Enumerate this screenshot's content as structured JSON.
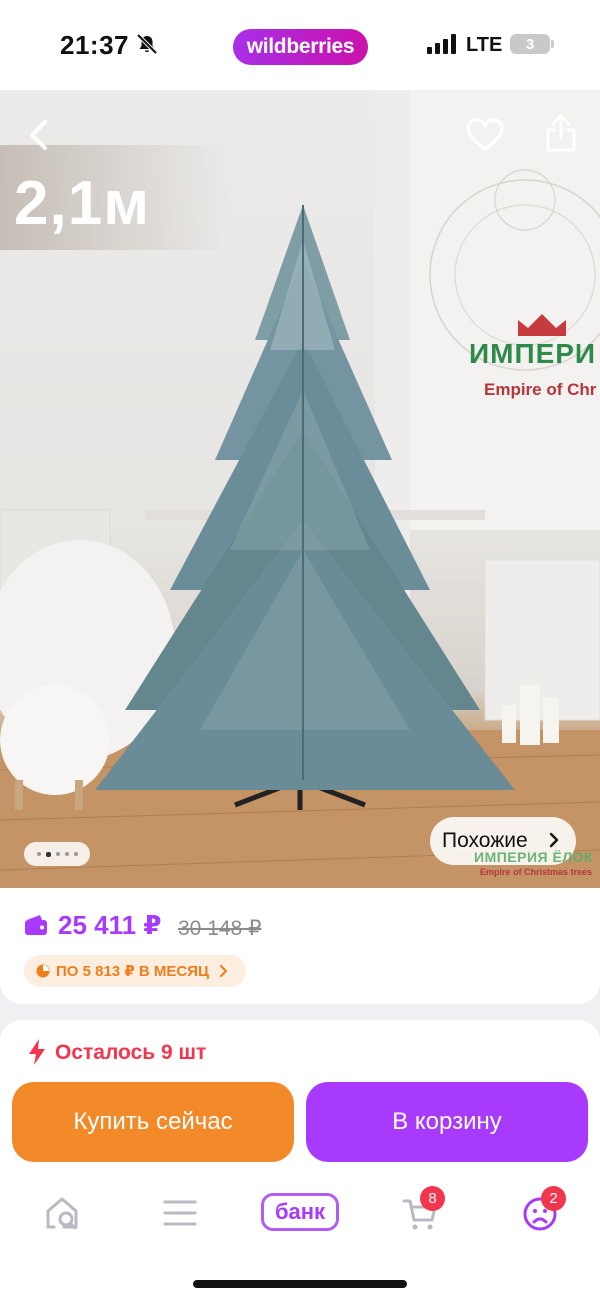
{
  "status_bar": {
    "time": "21:37",
    "brand": "wildberries",
    "network": "LTE",
    "battery": "3"
  },
  "product": {
    "size_label": "2,1м",
    "image_brand_ru": "ИМПЕРИ",
    "image_brand_en": "Empire of Chr",
    "watermark_ru": "ИМПЕРИЯ ЁЛОК",
    "watermark_en": "Empire of Christmas trees",
    "gallery_total": 5,
    "gallery_active": 2,
    "similar_label": "Похожие"
  },
  "pricing": {
    "price": "25 411 ₽",
    "old_price": "30 148 ₽",
    "installment": "ПО 5 813 ₽ В МЕСЯЦ"
  },
  "stock": {
    "text": "Осталось 9 шт"
  },
  "actions": {
    "buy_now": "Купить сейчас",
    "add_to_cart": "В корзину"
  },
  "tabbar": {
    "bank_label": "банк",
    "cart_badge": "8",
    "profile_badge": "2"
  },
  "colors": {
    "accent_purple": "#a73afd",
    "buy_orange": "#f38a2a",
    "alert_red": "#f2364e",
    "installment_orange": "#f07d1a"
  },
  "icons": [
    "back-icon",
    "heart-icon",
    "share-icon",
    "wallet-icon",
    "installment-icon",
    "bolt-icon",
    "home-search-icon",
    "catalog-icon",
    "cart-icon",
    "profile-icon"
  ]
}
